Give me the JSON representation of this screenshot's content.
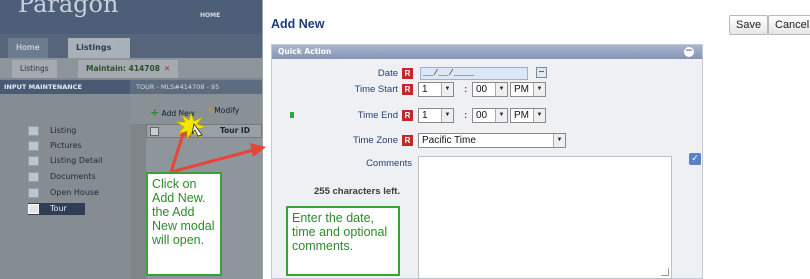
{
  "background_app": {
    "logo": "Paragon",
    "home_link": "HOME",
    "top_tabs": [
      {
        "label": "Home"
      },
      {
        "label": "Listings",
        "close": "✕"
      }
    ],
    "sub_tabs": [
      {
        "label": "Listings"
      },
      {
        "label": "Maintain: 414708",
        "close": "✕"
      }
    ],
    "section_title": "INPUT MAINTENANCE",
    "tour_bar_title": "TOUR - MLS#414708 - 95",
    "menu_items": [
      {
        "label": "Listing"
      },
      {
        "label": "Pictures"
      },
      {
        "label": "Listing Detail"
      },
      {
        "label": "Documents"
      },
      {
        "label": "Open House"
      },
      {
        "label": "Tour",
        "active": true
      }
    ],
    "toolbar": {
      "add_new": "Add New",
      "modify": "Modify"
    },
    "grid": {
      "column": "Tour ID"
    }
  },
  "annotations": {
    "left_callout": "Click on Add New. the Add New modal will open.",
    "right_callout": "Enter the date, time and optional comments.",
    "arrow_color": "#e8443a",
    "callout_color": "#3aa03a"
  },
  "modal": {
    "title": "Add New",
    "save_label": "Save",
    "cancel_label": "Cancel",
    "panel_title": "Quick Action",
    "collapse_glyph": "−",
    "required_marker": "R",
    "date_label": "Date",
    "date_value": "__/__/____",
    "time_start_label": "Time Start",
    "time_start": {
      "hour": "1",
      "minute": "00",
      "ampm": "PM"
    },
    "time_end_label": "Time End",
    "time_end": {
      "hour": "1",
      "minute": "00",
      "ampm": "PM"
    },
    "colon": ":",
    "time_zone_label": "Time Zone",
    "time_zone_value": "Pacific Time",
    "comments_label": "Comments",
    "chars_left": "255 characters left.",
    "dropdown_arrow": "▼",
    "check_glyph": "✓"
  }
}
